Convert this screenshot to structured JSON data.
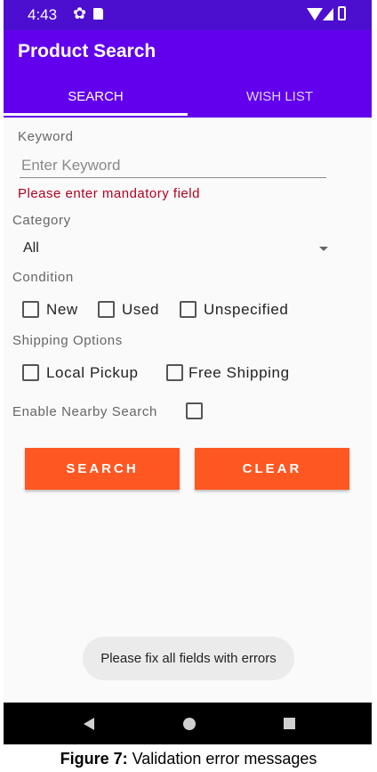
{
  "status_bar": {
    "time": "4:43"
  },
  "app_bar": {
    "title": "Product Search"
  },
  "tabs": [
    {
      "label": "SEARCH",
      "selected": true
    },
    {
      "label": "WISH LIST",
      "selected": false
    }
  ],
  "form": {
    "keyword": {
      "label": "Keyword",
      "placeholder": "Enter Keyword",
      "value": "",
      "error": "Please enter mandatory field"
    },
    "category": {
      "label": "Category",
      "selected": "All"
    },
    "condition": {
      "label": "Condition",
      "options": [
        {
          "label": "New",
          "checked": false
        },
        {
          "label": "Used",
          "checked": false
        },
        {
          "label": "Unspecified",
          "checked": false
        }
      ]
    },
    "shipping": {
      "label": "Shipping Options",
      "options": [
        {
          "label": "Local Pickup",
          "checked": false
        },
        {
          "label": "Free Shipping",
          "checked": false
        }
      ]
    },
    "nearby": {
      "label": "Enable Nearby Search",
      "checked": false
    }
  },
  "buttons": {
    "search": "SEARCH",
    "clear": "CLEAR"
  },
  "toast": "Please fix all fields with errors",
  "caption": {
    "prefix": "Figure 7:",
    "text": " Validation error messages"
  },
  "colors": {
    "status_bar": "#4c0fcf",
    "app_bar": "#6200ee",
    "accent": "#ff5722",
    "error": "#b00020"
  }
}
